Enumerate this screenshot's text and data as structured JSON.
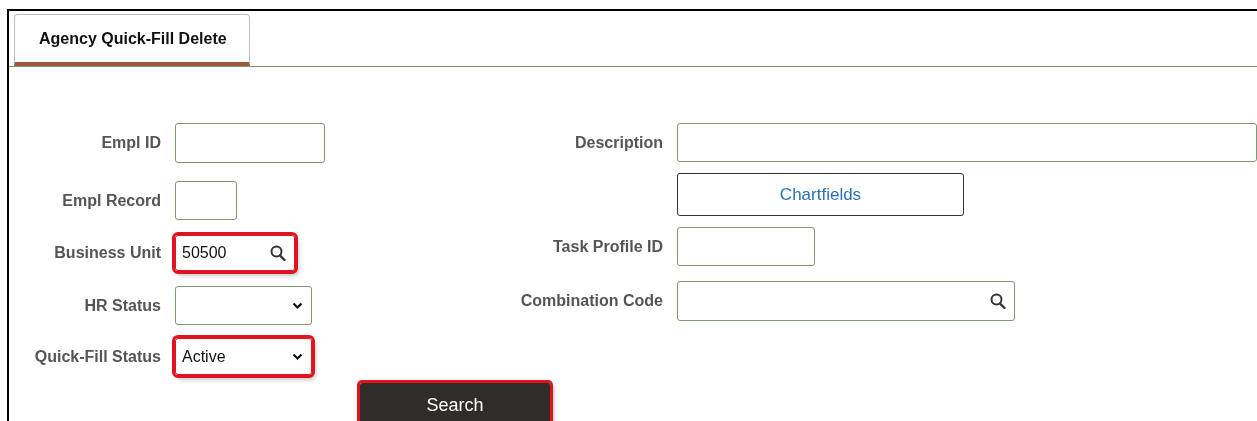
{
  "tabs": [
    {
      "label": "Agency Quick-Fill Delete",
      "selected": true
    }
  ],
  "left_fields": [
    {
      "label": "Empl ID",
      "kind": "text",
      "highlighted": false
    },
    {
      "label": "Empl Record",
      "kind": "text",
      "highlighted": false
    },
    {
      "label": "Business Unit",
      "kind": "lookup",
      "value": "50500",
      "highlighted": true
    },
    {
      "label": "HR Status",
      "kind": "select",
      "highlighted": false
    },
    {
      "label": "Quick-Fill Status",
      "kind": "select",
      "value": "Active",
      "highlighted": true
    }
  ],
  "right_fields": [
    {
      "label": "Description",
      "kind": "text",
      "highlighted": false
    },
    {
      "label": "Chartfields",
      "kind": "button",
      "highlighted": false
    },
    {
      "label": "Task Profile ID",
      "kind": "text",
      "highlighted": false
    },
    {
      "label": "Combination Code",
      "kind": "lookup",
      "highlighted": false
    }
  ],
  "search_button": {
    "label": "Search",
    "highlighted": true
  }
}
